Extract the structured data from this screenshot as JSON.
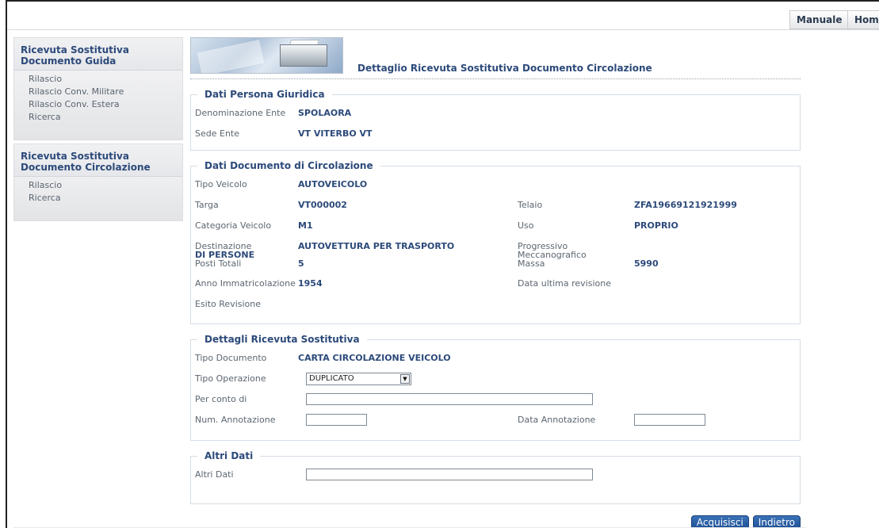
{
  "topnav": {
    "manuale": "Manuale",
    "home": "Home"
  },
  "sidebar": {
    "guida": {
      "title": "Ricevuta Sostitutiva Documento Guida",
      "items": [
        "Rilascio",
        "Rilascio Conv. Militare",
        "Rilascio Conv. Estera",
        "Ricerca"
      ]
    },
    "circolazione": {
      "title": "Ricevuta Sostitutiva Documento Circolazione",
      "items": [
        "Rilascio",
        "Ricerca"
      ]
    }
  },
  "page_title": "Dettaglio Ricevuta Sostitutiva Documento Circolazione",
  "persona": {
    "legend": "Dati Persona Giuridica",
    "denominazione_label": "Denominazione Ente",
    "denominazione_value": "SPOLAORA",
    "sede_label": "Sede Ente",
    "sede_value": "VT VITERBO VT"
  },
  "documento": {
    "legend": "Dati Documento di Circolazione",
    "tipo_veicolo_label": "Tipo Veicolo",
    "tipo_veicolo_value": "AUTOVEICOLO",
    "targa_label": "Targa",
    "targa_value": "VT000002",
    "telaio_label": "Telaio",
    "telaio_value": "ZFA19669121921999",
    "categoria_label": "Categoria Veicolo",
    "categoria_value": "M1",
    "uso_label": "Uso",
    "uso_value": "PROPRIO",
    "destinazione_label": "Destinazione",
    "destinazione_value_line1": "AUTOVETTURA PER TRASPORTO",
    "destinazione_value_line2": "DI PERSONE",
    "progressivo_label_line1": "Progressivo",
    "progressivo_label_line2": "Meccanografico",
    "posti_label": "Posti Totali",
    "posti_value": "5",
    "massa_label": "Massa",
    "massa_value": "5990",
    "anno_label": "Anno Immatricolazione",
    "anno_value": "1954",
    "data_revisione_label": "Data ultima revisione",
    "esito_label": "Esito Revisione"
  },
  "ricevuta": {
    "legend": "Dettagli Ricevuta Sostitutiva",
    "tipo_documento_label": "Tipo Documento",
    "tipo_documento_value": "CARTA CIRCOLAZIONE VEICOLO",
    "tipo_operazione_label": "Tipo Operazione",
    "tipo_operazione_value": "DUPLICATO",
    "per_conto_label": "Per conto di",
    "per_conto_value": "",
    "num_annotazione_label": "Num. Annotazione",
    "num_annotazione_value": "",
    "data_annotazione_label": "Data Annotazione",
    "data_annotazione_value": ""
  },
  "altri": {
    "legend": "Altri Dati",
    "label": "Altri Dati",
    "value": ""
  },
  "buttons": {
    "acquisisci": "Acquisisci",
    "indietro": "Indietro"
  }
}
